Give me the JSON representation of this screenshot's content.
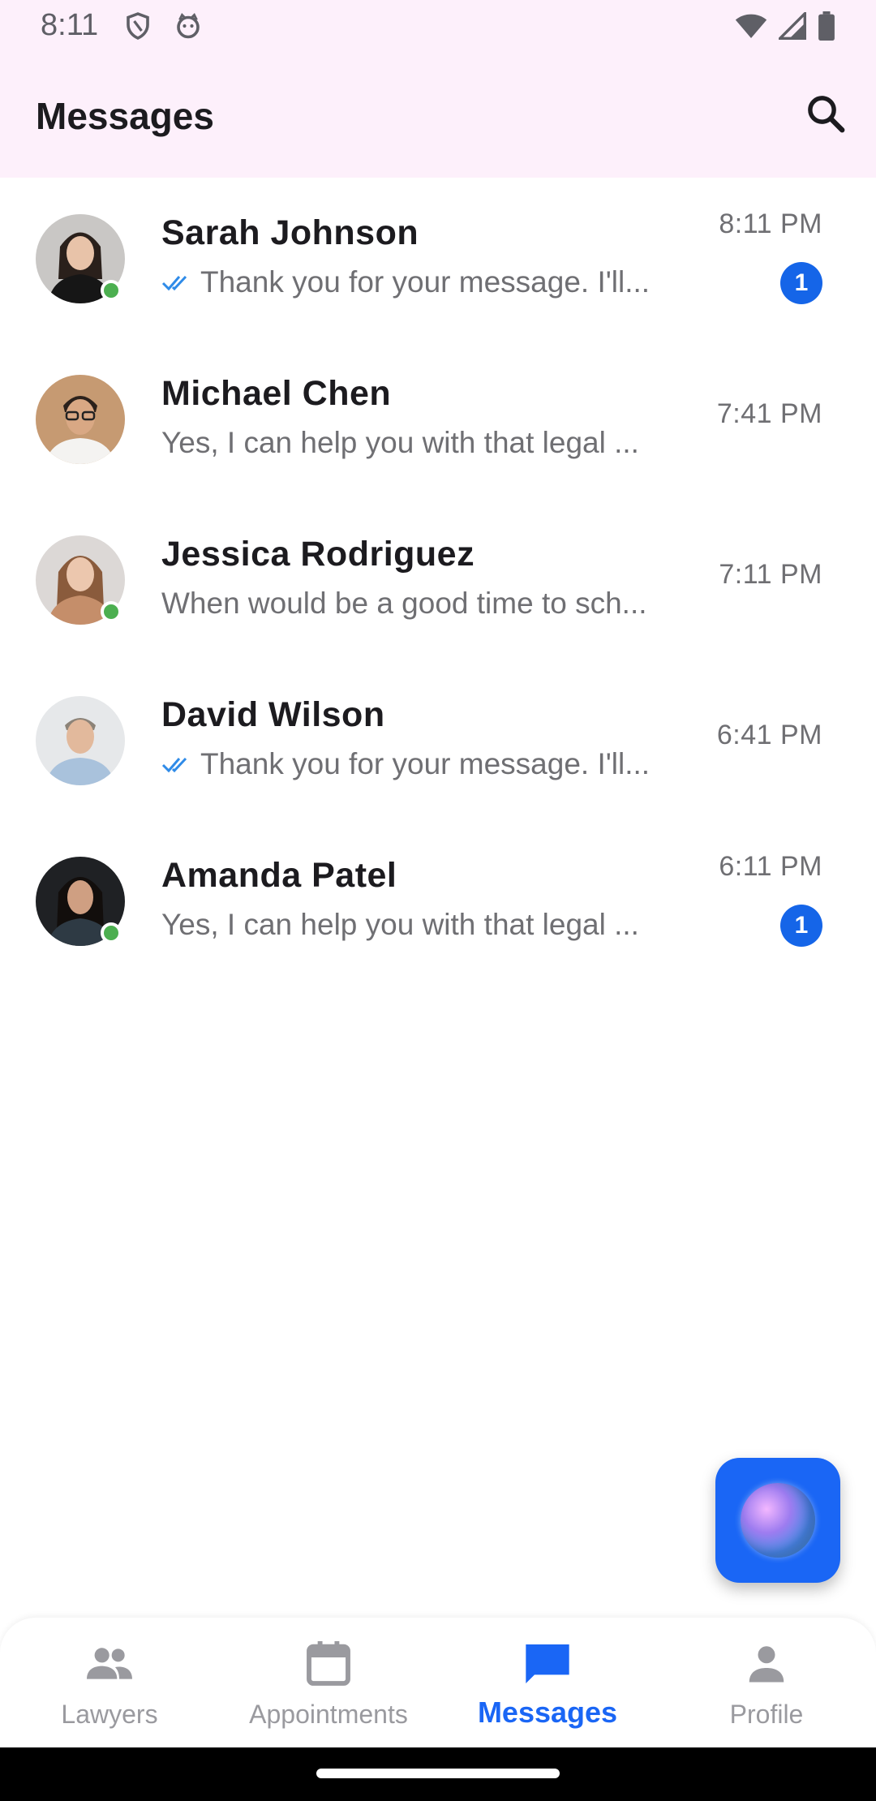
{
  "status_bar": {
    "time": "8:11",
    "icons": [
      "shield-icon",
      "cat-icon",
      "wifi-icon",
      "signal-icon",
      "battery-icon"
    ]
  },
  "app_bar": {
    "title": "Messages",
    "search_icon": "search-icon"
  },
  "conversations": [
    {
      "name": "Sarah Johnson",
      "preview": "Thank you for your message. I'll...",
      "time": "8:11 PM",
      "unread": "1",
      "online": true,
      "read_receipt": true
    },
    {
      "name": "Michael Chen",
      "preview": "Yes, I can help you with that legal ...",
      "time": "7:41 PM",
      "unread": null,
      "online": false,
      "read_receipt": false
    },
    {
      "name": "Jessica Rodriguez",
      "preview": "When would be a good time to sch...",
      "time": "7:11 PM",
      "unread": null,
      "online": true,
      "read_receipt": false
    },
    {
      "name": "David Wilson",
      "preview": "Thank you for your message. I'll...",
      "time": "6:41 PM",
      "unread": null,
      "online": false,
      "read_receipt": true
    },
    {
      "name": "Amanda Patel",
      "preview": "Yes, I can help you with that legal ...",
      "time": "6:11 PM",
      "unread": "1",
      "online": true,
      "read_receipt": false
    }
  ],
  "bottom_nav": {
    "items": [
      {
        "label": "Lawyers",
        "icon": "people-icon",
        "active": false
      },
      {
        "label": "Appointments",
        "icon": "calendar-icon",
        "active": false
      },
      {
        "label": "Messages",
        "icon": "chat-icon",
        "active": true
      },
      {
        "label": "Profile",
        "icon": "person-icon",
        "active": false
      }
    ]
  },
  "colors": {
    "accent": "#1a66f5",
    "badge": "#1565e8",
    "online": "#4caf50",
    "header_bg": "#fdf0fb",
    "read_check": "#2f8be8"
  },
  "fab": {
    "icon": "assistant-orb-icon"
  }
}
